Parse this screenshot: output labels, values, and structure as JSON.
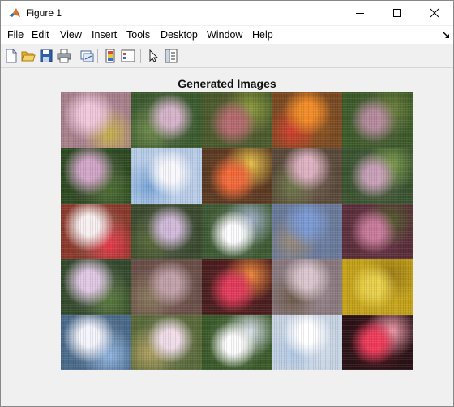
{
  "window": {
    "title": "Figure 1"
  },
  "menu": [
    "File",
    "Edit",
    "View",
    "Insert",
    "Tools",
    "Desktop",
    "Window",
    "Help"
  ],
  "toolbar": [
    {
      "name": "new-figure-icon"
    },
    {
      "name": "open-file-icon"
    },
    {
      "name": "save-icon"
    },
    {
      "name": "print-icon"
    },
    {
      "name": "link-plot-icon"
    },
    {
      "name": "colorbar-icon"
    },
    {
      "name": "legend-icon"
    },
    {
      "name": "edit-plot-arrow-icon"
    },
    {
      "name": "property-inspector-icon"
    }
  ],
  "axes": {
    "title": "Generated Images",
    "grid_rows": 5,
    "grid_cols": 5,
    "tiles": [
      {
        "base": "#a7808c",
        "c1": "#f0c8dc",
        "c2": "#c8b24a"
      },
      {
        "base": "#3b5a2e",
        "c1": "#d4b2c8",
        "c2": "#6e8a4a"
      },
      {
        "base": "#4a5a2c",
        "c1": "#b46a6e",
        "c2": "#8a9a3c"
      },
      {
        "base": "#7a4a22",
        "c1": "#f08a26",
        "c2": "#d43e2e"
      },
      {
        "base": "#3d5a2a",
        "c1": "#b48a9c",
        "c2": "#6a7e3a"
      },
      {
        "base": "#2e4a22",
        "c1": "#d2a6c8",
        "c2": "#4e6e34"
      },
      {
        "base": "#b8cce8",
        "c1": "#f8f8fc",
        "c2": "#7aa6d8"
      },
      {
        "base": "#5a3a22",
        "c1": "#f26a3a",
        "c2": "#e8c44a"
      },
      {
        "base": "#5a4a3a",
        "c1": "#dcb0c0",
        "c2": "#6e7a4a"
      },
      {
        "base": "#3a5430",
        "c1": "#c8a0b8",
        "c2": "#7a9a4a"
      },
      {
        "base": "#8a3a2c",
        "c1": "#f8f0f0",
        "c2": "#e83a4a"
      },
      {
        "base": "#3a4a2e",
        "c1": "#d0b8d8",
        "c2": "#5a6a3a"
      },
      {
        "base": "#3e5a34",
        "c1": "#fcfcfe",
        "c2": "#a0b0c8"
      },
      {
        "base": "#6a7a9a",
        "c1": "#7a98d0",
        "c2": "#9a8a78"
      },
      {
        "base": "#5a2e3a",
        "c1": "#c87a9a",
        "c2": "#4e5a2a"
      },
      {
        "base": "#344a2c",
        "c1": "#e0c8e4",
        "c2": "#5a7a3e"
      },
      {
        "base": "#6a5048",
        "c1": "#c0a0a8",
        "c2": "#8a7a5e"
      },
      {
        "base": "#4a1e1e",
        "c1": "#e23a5a",
        "c2": "#f08a3a"
      },
      {
        "base": "#8a7a80",
        "c1": "#d8c4cc",
        "c2": "#6e5a4a"
      },
      {
        "base": "#c4a21a",
        "c1": "#e8d04a",
        "c2": "#9a7a16"
      },
      {
        "base": "#4a6a8a",
        "c1": "#f4f4fc",
        "c2": "#90b4e0"
      },
      {
        "base": "#5a6a3a",
        "c1": "#f0dce8",
        "c2": "#b0a060"
      },
      {
        "base": "#3a5a2a",
        "c1": "#fcfcfc",
        "c2": "#d6dde8"
      },
      {
        "base": "#c8d4e4",
        "c1": "#ffffff",
        "c2": "#b0c8e4"
      },
      {
        "base": "#2a1216",
        "c1": "#f03a5a",
        "c2": "#f2a0b0"
      }
    ]
  }
}
